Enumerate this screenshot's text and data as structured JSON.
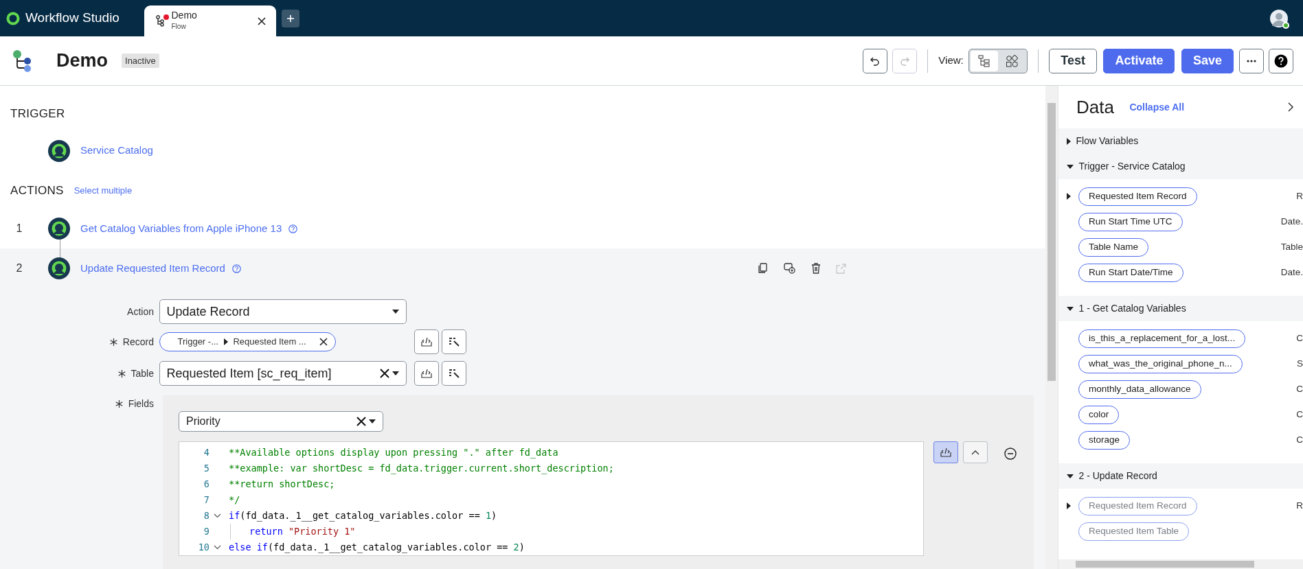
{
  "app": {
    "title": "Workflow Studio"
  },
  "tabs": [
    {
      "title": "Demo",
      "subtitle": "Flow",
      "selected": true,
      "unsaved": true
    }
  ],
  "user": {
    "online": true
  },
  "header": {
    "title": "Demo",
    "status": "Inactive",
    "undo_disabled": false,
    "redo_disabled": true,
    "view_label": "View:",
    "view_modes": [
      {
        "kind": "tree",
        "selected": true
      },
      {
        "kind": "grid",
        "selected": false
      }
    ],
    "buttons": [
      {
        "label": "Test",
        "kind": "outline"
      },
      {
        "label": "Activate",
        "kind": "primary"
      },
      {
        "label": "Save",
        "kind": "primary"
      }
    ]
  },
  "trigger": {
    "heading": "TRIGGER",
    "name": "Service Catalog"
  },
  "actions": {
    "heading": "ACTIONS",
    "select_link": "Select multiple",
    "items": [
      {
        "number": "1",
        "name": "Get Catalog Variables from Apple iPhone 13",
        "expanded": false
      },
      {
        "number": "2",
        "name": "Update Requested Item Record",
        "expanded": true
      }
    ]
  },
  "form": {
    "action": {
      "label": "Action",
      "value": "Update Record",
      "required": false
    },
    "record": {
      "label": "Record",
      "required": true,
      "segments": [
        "Trigger -...",
        "Requested Item ..."
      ]
    },
    "table": {
      "label": "Table",
      "required": true,
      "value": "Requested Item [sc_req_item]"
    },
    "fields": {
      "label": "Fields",
      "required": true,
      "field": "Priority",
      "script_mode": true,
      "code_lines": [
        {
          "number": "4",
          "fold": false,
          "guide": false,
          "tokens": [
            {
              "kind": "comment",
              "text": "**Available options display upon pressing \".\" after fd_data"
            }
          ]
        },
        {
          "number": "5",
          "fold": false,
          "guide": false,
          "tokens": [
            {
              "kind": "comment",
              "text": "**example: var shortDesc = fd_data.trigger.current.short_description;"
            }
          ]
        },
        {
          "number": "6",
          "fold": false,
          "guide": false,
          "tokens": [
            {
              "kind": "comment",
              "text": "**return shortDesc;"
            }
          ]
        },
        {
          "number": "7",
          "fold": false,
          "guide": false,
          "tokens": [
            {
              "kind": "comment",
              "text": "*/"
            }
          ]
        },
        {
          "number": "8",
          "fold": true,
          "guide": false,
          "tokens": [
            {
              "kind": "keyword",
              "text": "if"
            },
            {
              "kind": "plain",
              "text": "(fd_data._1__get_catalog_variables.color == "
            },
            {
              "kind": "number",
              "text": "1"
            },
            {
              "kind": "plain",
              "text": ")"
            }
          ]
        },
        {
          "number": "9",
          "fold": false,
          "guide": true,
          "tokens": [
            {
              "kind": "keyword",
              "text": "return"
            },
            {
              "kind": "string",
              "text": " \"Priority 1\""
            }
          ]
        },
        {
          "number": "10",
          "fold": true,
          "guide": false,
          "tokens": [
            {
              "kind": "keyword",
              "text": "else if"
            },
            {
              "kind": "plain",
              "text": "(fd_data._1__get_catalog_variables.color == "
            },
            {
              "kind": "number",
              "text": "2"
            },
            {
              "kind": "plain",
              "text": ")"
            }
          ]
        }
      ]
    }
  },
  "data_panel": {
    "title": "Data",
    "collapse_link": "Collapse All",
    "sections": [
      {
        "title": "Flow Variables",
        "expanded": false
      },
      {
        "title": "Trigger - Service Catalog",
        "expanded": true,
        "items": [
          {
            "label": "Requested Item Record",
            "type": "R",
            "expandable": true,
            "disabled": false
          },
          {
            "label": "Run Start Time UTC",
            "type": "Date.",
            "expandable": false,
            "disabled": false
          },
          {
            "label": "Table Name",
            "type": "Table",
            "expandable": false,
            "disabled": false
          },
          {
            "label": "Run Start Date/Time",
            "type": "Date.",
            "expandable": false,
            "disabled": false
          }
        ]
      },
      {
        "title": "1 - Get Catalog Variables",
        "expanded": true,
        "items": [
          {
            "label": "is_this_a_replacement_for_a_lost...",
            "type": "C",
            "expandable": false,
            "disabled": false
          },
          {
            "label": "what_was_the_original_phone_n...",
            "type": "S",
            "expandable": false,
            "disabled": false
          },
          {
            "label": "monthly_data_allowance",
            "type": "C",
            "expandable": false,
            "disabled": false
          },
          {
            "label": "color",
            "type": "C",
            "expandable": false,
            "disabled": false
          },
          {
            "label": "storage",
            "type": "C",
            "expandable": false,
            "disabled": false
          }
        ]
      },
      {
        "title": "2 - Update Record",
        "expanded": true,
        "items": [
          {
            "label": "Requested Item Record",
            "type": "R",
            "expandable": true,
            "disabled": true
          },
          {
            "label": "Requested Item Table",
            "expandable": false,
            "disabled": true
          }
        ]
      }
    ]
  }
}
